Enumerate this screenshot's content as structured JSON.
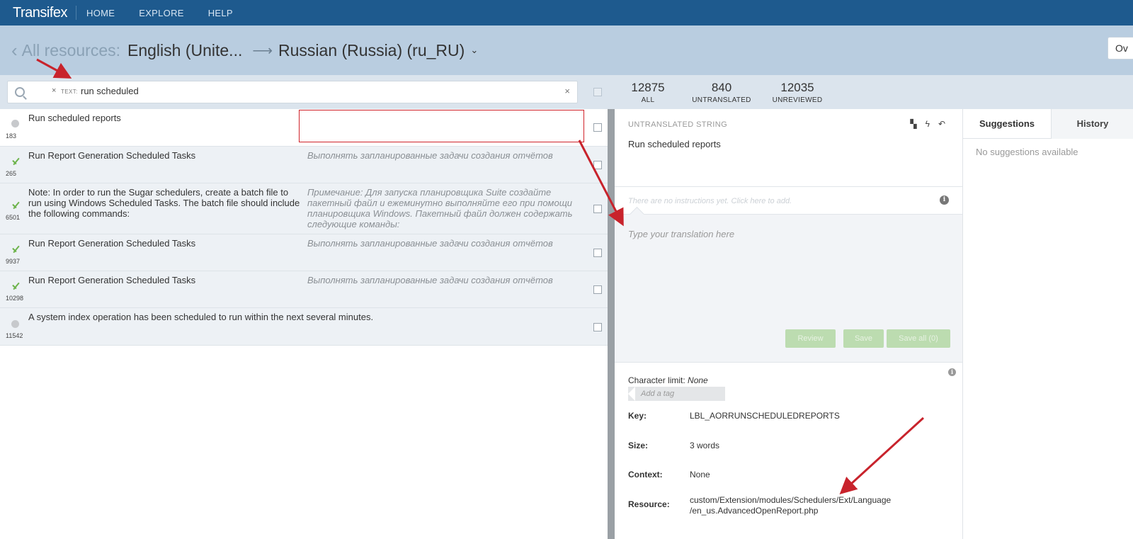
{
  "nav": {
    "brand": "Transifex",
    "links": [
      "HOME",
      "EXPLORE",
      "HELP"
    ]
  },
  "header": {
    "back": "All resources:",
    "source_lang": "English (Unite...",
    "target_lang": "Russian (Russia) (ru_RU)",
    "overview_btn": "Ov"
  },
  "filter": {
    "tag_label": "TEXT:",
    "tag_value": "run scheduled",
    "clear": "×",
    "tag_remove": "×"
  },
  "stats": [
    {
      "value": "12875",
      "label": "ALL"
    },
    {
      "value": "840",
      "label": "UNTRANSLATED"
    },
    {
      "value": "12035",
      "label": "UNREVIEWED"
    }
  ],
  "rows": [
    {
      "id": "183",
      "status": "untranslated",
      "source": "Run scheduled reports",
      "translation": ""
    },
    {
      "id": "265",
      "status": "translated",
      "source": "Run Report Generation Scheduled Tasks",
      "translation": "Выполнять запланированные задачи создания отчётов"
    },
    {
      "id": "6501",
      "status": "translated",
      "source": "Note: In order to run the Sugar schedulers, create a batch file to run using Windows Scheduled Tasks. The batch file should include the following commands:",
      "translation": "Примечание: Для запуска планировщика Suite создайте пакетный файл и ежеминутно выполняйте его при помощи планировщика Windows. Пакетный файл должен содержать следующие команды:"
    },
    {
      "id": "9937",
      "status": "translated",
      "source": "Run Report Generation Scheduled Tasks",
      "translation": "Выполнять запланированные задачи создания отчётов"
    },
    {
      "id": "10298",
      "status": "translated",
      "source": "Run Report Generation Scheduled Tasks",
      "translation": "Выполнять запланированные задачи создания отчётов"
    },
    {
      "id": "11542",
      "status": "untranslated",
      "source": "A system index operation has been scheduled to run within the next several minutes.",
      "translation": ""
    }
  ],
  "editor": {
    "source_title": "UNTRANSLATED STRING",
    "source_text": "Run scheduled reports",
    "instructions": "There are no instructions yet. Click here to add.",
    "placeholder": "Type your translation here",
    "buttons": {
      "review": "Review",
      "save": "Save",
      "save_all": "Save all (0)"
    },
    "char_limit_label": "Character limit:",
    "char_limit_value": "None",
    "add_tag": "Add a tag",
    "meta": [
      {
        "key": "Key:",
        "value": "LBL_AORRUNSCHEDULEDREPORTS"
      },
      {
        "key": "Size:",
        "value": "3 words"
      },
      {
        "key": "Context:",
        "value": "None"
      },
      {
        "key": "Resource:",
        "value_line1": "custom/Extension/modules/Schedulers/Ext/Language",
        "value_line2": "/en_us.AdvancedOpenReport.php"
      }
    ]
  },
  "right": {
    "tabs": [
      "Suggestions",
      "History"
    ],
    "empty": "No suggestions available"
  },
  "colors": {
    "nav_bg": "#1e5a8e",
    "header_bg": "#b9cde0",
    "annotation_red": "#c8232c",
    "button_green": "#bcdcb0",
    "check_green": "#6cb34a"
  }
}
